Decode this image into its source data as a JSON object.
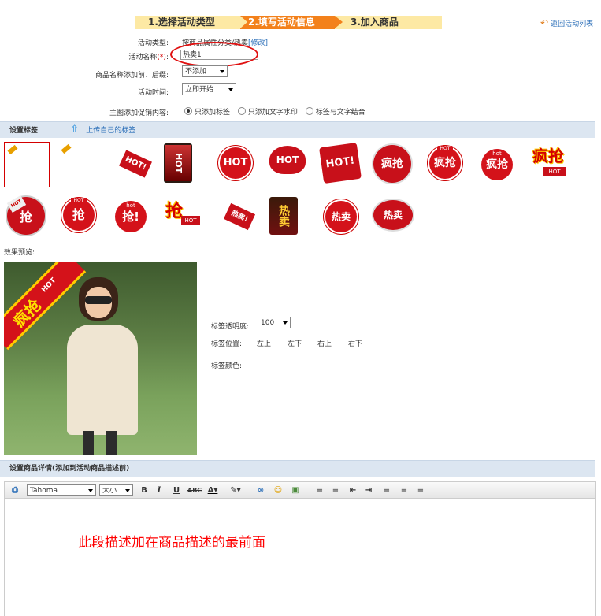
{
  "steps": [
    "1.选择活动类型",
    "2.填写活动信息",
    "3.加入商品"
  ],
  "back_link": "返回活动列表",
  "form": {
    "type_label": "活动类型:",
    "type_value": "按商品属性分类/热卖",
    "type_edit": "[修改]",
    "name_label": "活动名称",
    "name_required": "(*)",
    "name_colon": ":",
    "name_value": "热卖1",
    "prefix_label": "商品名称添加前、后缀:",
    "prefix_value": "不添加",
    "time_label": "活动时间:",
    "time_value": "立即开始",
    "promo_label": "主图添加促销内容:",
    "promo_options": [
      "只添加标签",
      "只添加文字水印",
      "标签与文字结合"
    ]
  },
  "tags_section": {
    "title": "设置标签",
    "upload": "上传自己的标签",
    "row1": [
      "",
      "",
      "HOT!",
      "HOT",
      "HOT",
      "HOT",
      "HOT!",
      "疯抢",
      "疯抢",
      "疯抢",
      "疯抢"
    ],
    "row1_sub": [
      "",
      "",
      "",
      "",
      "",
      "",
      "",
      "",
      "HOT",
      "hot",
      "HOT"
    ],
    "row2": [
      "抢",
      "抢",
      "抢!",
      "抢",
      "热卖!",
      "热卖",
      "热卖",
      "热卖"
    ],
    "row2_sub": [
      "HOT",
      "HOT",
      "hot",
      "HOT",
      "",
      "",
      "",
      ""
    ]
  },
  "preview": {
    "label": "效果预览:",
    "ribbon_main": "疯抢",
    "ribbon_sub": "HOT",
    "opacity_label": "标签透明度:",
    "opacity_value": "100",
    "position_label": "标签位置:",
    "positions": [
      "左上",
      "左下",
      "右上",
      "右下"
    ],
    "color_label": "标签颜色:"
  },
  "details": {
    "title": "设置商品详情(添加到活动商品描述前)",
    "font_value": "Tahoma",
    "size_value": "大小",
    "editor_text": "此段描述加在商品描述的最前面"
  },
  "colors": {
    "accent": "#f3811b",
    "red": "#d40000",
    "link": "#2a6eb8"
  }
}
